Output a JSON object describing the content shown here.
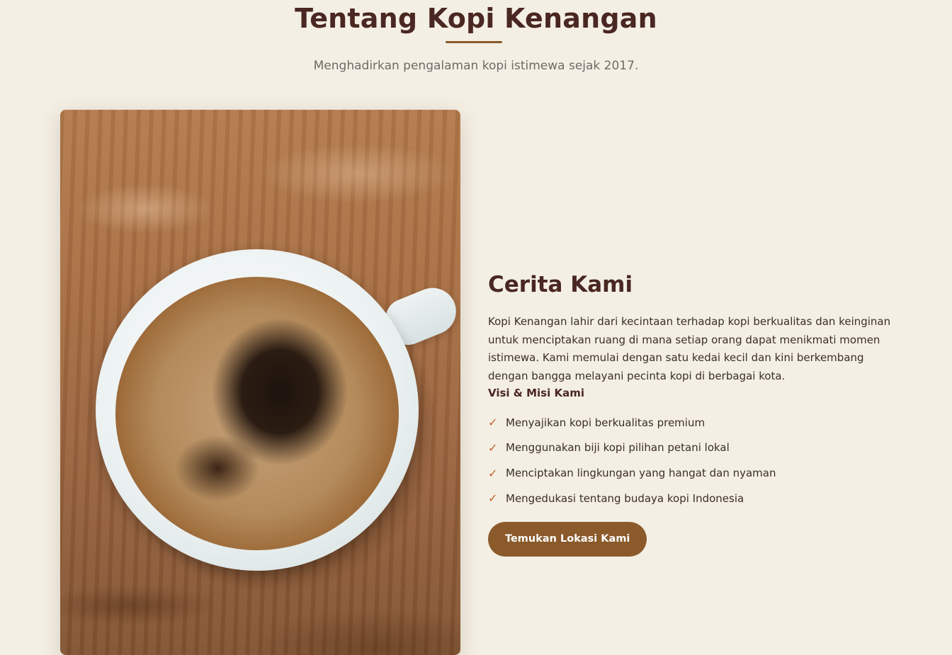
{
  "header": {
    "title": "Tentang Kopi Kenangan",
    "subtitle": "Menghadirkan pengalaman kopi istimewa sejak 2017."
  },
  "image": {
    "subject": "coffee-cup-photo"
  },
  "story": {
    "heading": "Cerita Kami",
    "text": "Kopi Kenangan lahir dari kecintaan terhadap kopi berkualitas dan keinginan untuk menciptakan ruang di mana setiap orang dapat menikmati momen istimewa. Kami memulai dengan satu kedai kecil dan kini berkembang dengan bangga melayani pecinta kopi di berbagai kota."
  },
  "vision_mission": {
    "heading": "Visi & Misi Kami",
    "check_glyph": "✓",
    "items": [
      "Menyajikan kopi berkualitas premium",
      "Menggunakan biji kopi pilihan petani lokal",
      "Menciptakan lingkungan yang hangat dan nyaman",
      "Mengedukasi tentang budaya kopi Indonesia"
    ]
  },
  "cta": {
    "label": "Temukan Lokasi Kami"
  },
  "colors": {
    "background": "#f4efe4",
    "heading": "#4a2722",
    "accent": "#8b5a2b",
    "check": "#c0612a"
  }
}
